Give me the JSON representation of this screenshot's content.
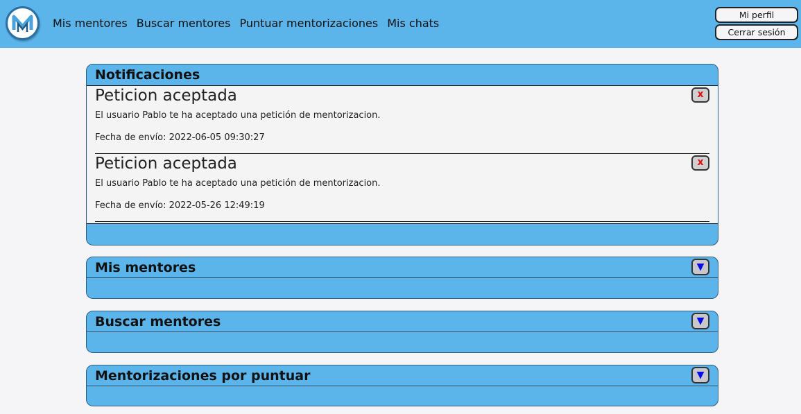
{
  "header": {
    "logo_icon": "mentor-m-logo",
    "nav": [
      "Mis mentores",
      "Buscar mentores",
      "Puntuar mentorizaciones",
      "Mis chats"
    ],
    "profile_label": "Mi perfil",
    "logout_label": "Cerrar sesión"
  },
  "notifications": {
    "title": "Notificaciones",
    "items": [
      {
        "title": "Peticion aceptada",
        "message": "El usuario Pablo te ha aceptado una petición de mentorizacion.",
        "date": "Fecha de envío: 2022-06-05 09:30:27",
        "close_label": "x"
      },
      {
        "title": "Peticion aceptada",
        "message": "El usuario Pablo te ha aceptado una petición de mentorizacion.",
        "date": "Fecha de envío: 2022-05-26 12:49:19",
        "close_label": "x"
      }
    ]
  },
  "sections": [
    {
      "title": "Mis mentores",
      "toggle": "▼"
    },
    {
      "title": "Buscar mentores",
      "toggle": "▼"
    },
    {
      "title": "Mentorizaciones por puntuar",
      "toggle": "▼"
    }
  ],
  "colors": {
    "header_bg": "#5bb4ea",
    "panel_bg": "#5bb4ea",
    "page_bg": "#f5f5f7",
    "close_x": "#e01010",
    "toggle_arrow": "#0a0ae6"
  }
}
